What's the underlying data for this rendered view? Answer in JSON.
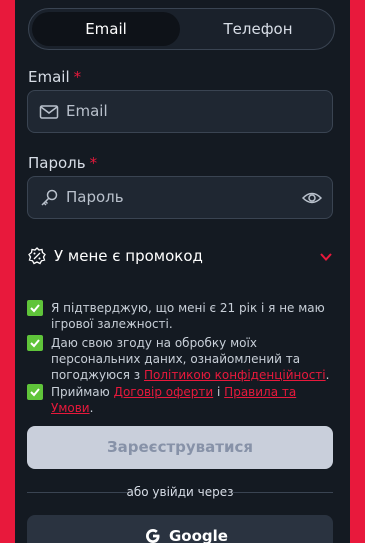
{
  "tabs": {
    "email_label": "Email",
    "phone_label": "Телефон"
  },
  "email": {
    "label": "Email",
    "required_mark": "*",
    "placeholder": "Email",
    "icon": "envelope-icon"
  },
  "password": {
    "label": "Пароль",
    "required_mark": "*",
    "placeholder": "Пароль",
    "icon": "key-icon",
    "toggle_icon": "eye-icon"
  },
  "promo": {
    "label": "У мене є промокод",
    "icon": "percent-badge-icon",
    "chevron_icon": "chevron-down-icon"
  },
  "agreements": {
    "age": "Я підтверджую, що мені є 21 рік і я не маю ігрової залежності.",
    "privacy_text": "Даю свою згоду на обробку моїх персональних даних, ознайомлений та погоджуюся з",
    "privacy_link": "Політикою конфіденційності",
    "privacy_end": ".",
    "terms_text": "Приймаю",
    "terms_link1": "Договір оферти",
    "terms_and": "і",
    "terms_link2": "Правила та Умови",
    "terms_end": "."
  },
  "submit_label": "Зареєструватися",
  "divider_text": "або увійди через",
  "google_label": "Google",
  "colors": {
    "accent": "#e8193c",
    "check": "#5fc43a",
    "panel": "#141a22"
  }
}
